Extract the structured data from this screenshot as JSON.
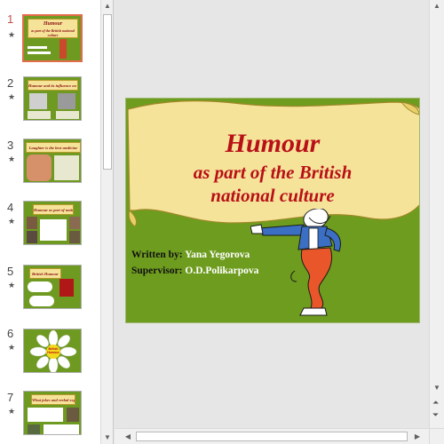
{
  "thumbnails": [
    {
      "number": "1",
      "title": "Humour",
      "subtitle": "as part of the British national culture",
      "active": true
    },
    {
      "number": "2",
      "title": "Humour and its influence on the lives of people",
      "active": false
    },
    {
      "number": "3",
      "title": "Laughter is the best medicine",
      "active": false
    },
    {
      "number": "4",
      "title": "Humour as part of national culture",
      "active": false
    },
    {
      "number": "5",
      "title": "British Humour",
      "active": false
    },
    {
      "number": "6",
      "title": "British Humour",
      "active": false
    },
    {
      "number": "7",
      "title": "What jokes and verbal expressions",
      "active": false
    }
  ],
  "slide": {
    "title": "Humour",
    "subtitle_line1": "as part of the British",
    "subtitle_line2": "national culture",
    "written_label": "Written by:",
    "written_value": "Yana Yegorova",
    "supervisor_label": "Supervisor:",
    "supervisor_value": "O.D.Polikarpova"
  },
  "colors": {
    "slide_background": "#6e9c1f",
    "banner": "#f6e39a",
    "title_text": "#b81016",
    "active_thumb_border": "#e46c4a"
  },
  "icons": {
    "scroll_up": "▲",
    "scroll_down": "▼",
    "scroll_left": "◀",
    "scroll_right": "▶",
    "prev_slide": "⏶",
    "next_slide": "⏷",
    "effect_star": "★"
  }
}
